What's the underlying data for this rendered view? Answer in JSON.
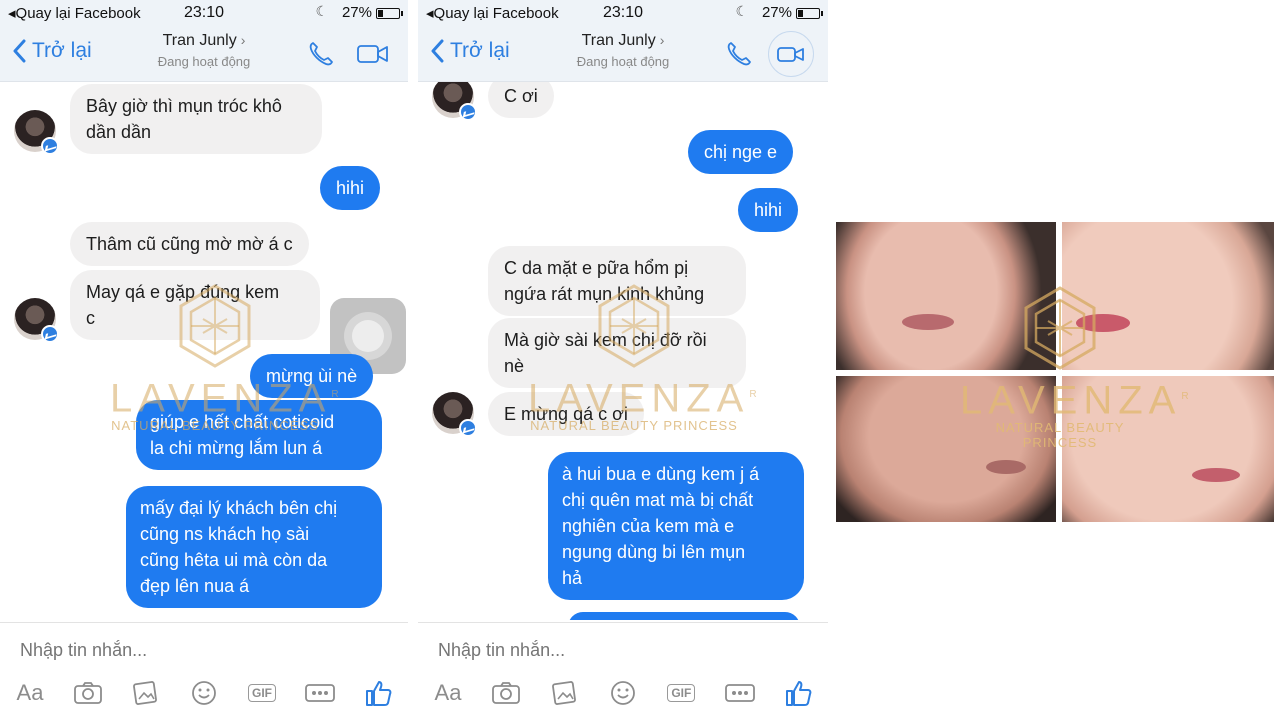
{
  "phones": [
    {
      "status": {
        "back_app": "Quay lại Facebook",
        "time": "23:10",
        "battery": "27%",
        "battery_level": 0.27
      },
      "nav": {
        "back": "Trở lại",
        "name": "Tran Junly",
        "presence": "Đang hoạt động"
      },
      "messages": [
        "Bây giờ thì mụn tróc khô",
        "dần dần",
        "hihi",
        "Thâm cũ cũng mờ mờ á c",
        "May qá e gặp đúng kem",
        "c",
        "mừng ùi nè",
        "giúp e hết chất coticoid",
        "la chi mừng lắm lun á",
        "mấy đại lý khách bên chị",
        "cũng ns khách họ sài",
        "cũng hêta ui mà còn da",
        "đẹp lên nua á"
      ],
      "composer": {
        "placeholder": "Nhập tin nhắn...",
        "aa": "Aa",
        "gif": "GIF"
      }
    },
    {
      "status": {
        "back_app": "Quay lại Facebook",
        "time": "23:10",
        "battery": "27%",
        "battery_level": 0.27
      },
      "nav": {
        "back": "Trở lại",
        "name": "Tran Junly",
        "presence": "Đang hoạt động"
      },
      "messages": [
        "C ơi",
        "chị nge e",
        "hihi",
        "C da mặt e pữa hổm pị",
        "ngứa rát mụn kinh khủng",
        "Mà giờ sài kem chị đỡ rồi",
        "nè",
        "E mừng qá c ơi",
        "à hui bua e dùng kem j á",
        "chị quên mat mà bị chất",
        "nghiên của kem mà e",
        "ngung dùng bi lên mụn",
        "hả"
      ],
      "composer": {
        "placeholder": "Nhập tin nhắn...",
        "aa": "Aa",
        "gif": "GIF"
      }
    }
  ],
  "watermark": {
    "brand": "LAVENZA",
    "reg": "R",
    "tagline": "NATURAL BEAUTY PRINCESS"
  },
  "icons": [
    "back-chevron-icon",
    "phone-icon",
    "video-camera-icon",
    "camera-icon",
    "gallery-icon",
    "emoji-icon",
    "gif-icon",
    "more-icon",
    "like-icon",
    "messenger-badge-icon"
  ],
  "colors": {
    "accent": "#1f7bf0",
    "incoming": "#f1f0f0",
    "watermark": "#d6aa60"
  }
}
